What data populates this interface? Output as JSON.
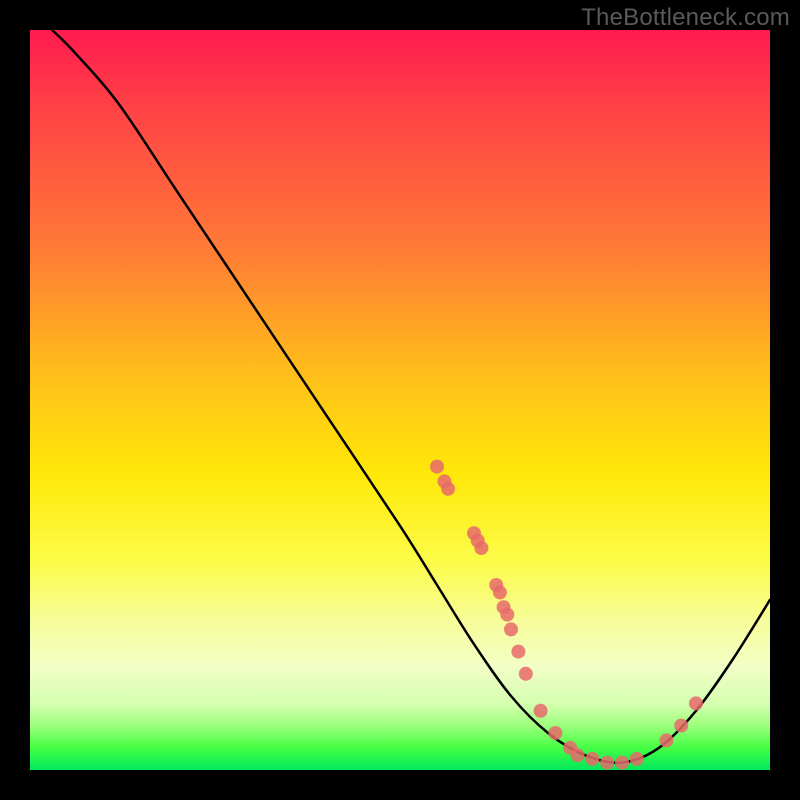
{
  "watermark": "TheBottleneck.com",
  "chart_data": {
    "type": "line",
    "title": "",
    "xlabel": "",
    "ylabel": "",
    "xlim": [
      0,
      100
    ],
    "ylim": [
      0,
      100
    ],
    "curve": {
      "name": "bottleneck-curve",
      "color": "#000000",
      "points": [
        {
          "x": 3,
          "y": 100
        },
        {
          "x": 6,
          "y": 97
        },
        {
          "x": 12,
          "y": 90
        },
        {
          "x": 20,
          "y": 78
        },
        {
          "x": 30,
          "y": 63
        },
        {
          "x": 40,
          "y": 48
        },
        {
          "x": 50,
          "y": 33
        },
        {
          "x": 55,
          "y": 25
        },
        {
          "x": 60,
          "y": 17
        },
        {
          "x": 65,
          "y": 10
        },
        {
          "x": 70,
          "y": 5
        },
        {
          "x": 75,
          "y": 2
        },
        {
          "x": 80,
          "y": 1
        },
        {
          "x": 85,
          "y": 3
        },
        {
          "x": 90,
          "y": 8
        },
        {
          "x": 95,
          "y": 15
        },
        {
          "x": 100,
          "y": 23
        }
      ]
    },
    "markers": {
      "name": "data-points",
      "color": "#e86a6a",
      "points": [
        {
          "x": 55,
          "y": 41
        },
        {
          "x": 56,
          "y": 39
        },
        {
          "x": 56.5,
          "y": 38
        },
        {
          "x": 60,
          "y": 32
        },
        {
          "x": 60.5,
          "y": 31
        },
        {
          "x": 61,
          "y": 30
        },
        {
          "x": 63,
          "y": 25
        },
        {
          "x": 63.5,
          "y": 24
        },
        {
          "x": 64,
          "y": 22
        },
        {
          "x": 64.5,
          "y": 21
        },
        {
          "x": 65,
          "y": 19
        },
        {
          "x": 66,
          "y": 16
        },
        {
          "x": 67,
          "y": 13
        },
        {
          "x": 69,
          "y": 8
        },
        {
          "x": 71,
          "y": 5
        },
        {
          "x": 73,
          "y": 3
        },
        {
          "x": 74,
          "y": 2
        },
        {
          "x": 76,
          "y": 1.5
        },
        {
          "x": 78,
          "y": 1
        },
        {
          "x": 80,
          "y": 1
        },
        {
          "x": 82,
          "y": 1.5
        },
        {
          "x": 86,
          "y": 4
        },
        {
          "x": 88,
          "y": 6
        },
        {
          "x": 90,
          "y": 9
        }
      ]
    }
  }
}
